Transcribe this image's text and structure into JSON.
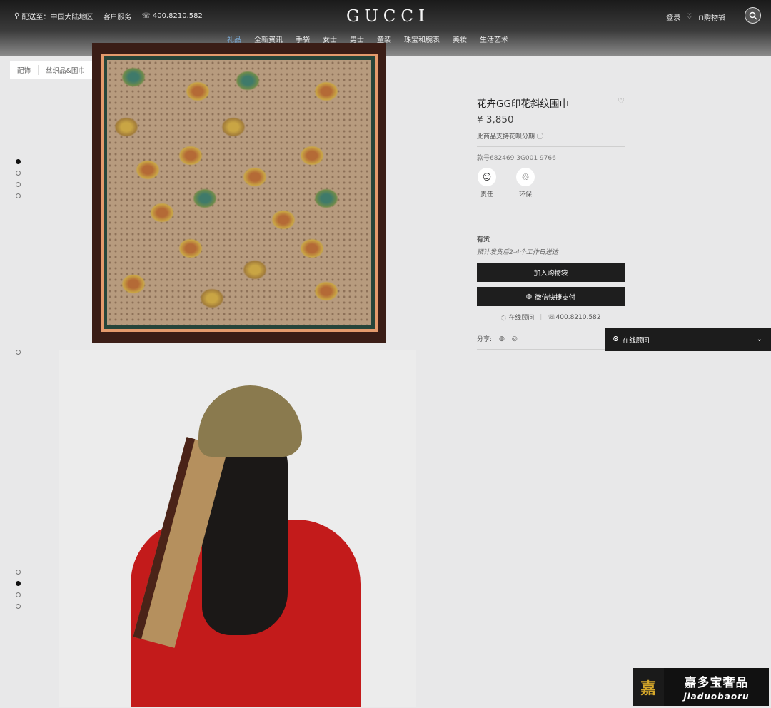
{
  "header": {
    "ship_to": "配送至：中国大陆地区",
    "service": "客户服务",
    "phone": "400.8210.582",
    "logo": "GUCCI",
    "login": "登录",
    "bag": "购物袋"
  },
  "nav": [
    "礼品",
    "全新资讯",
    "手袋",
    "女士",
    "男士",
    "童装",
    "珠宝和腕表",
    "美妆",
    "生活艺术"
  ],
  "breadcrumb": [
    "配饰",
    "丝织品&围巾"
  ],
  "product": {
    "title": "花卉GG印花斜纹围巾",
    "price": "¥ 3,850",
    "installment": "此商品支持花呗分期",
    "sku": "款号682469 3G001 9766",
    "badges": [
      "责任",
      "环保"
    ],
    "stock": "有货",
    "delivery": "预计发货后2-4个工作日送达",
    "add_to_bag": "加入购物袋",
    "wechat_pay": "微信快捷支付",
    "online_advisor": "在线顾问",
    "phone": "400.8210.582",
    "share": "分享:"
  },
  "chat_bar": {
    "label": "在线顾问"
  },
  "watermark": {
    "cn": "嘉多宝奢品",
    "en": "jiaduobaoru",
    "mark": "嘉"
  }
}
